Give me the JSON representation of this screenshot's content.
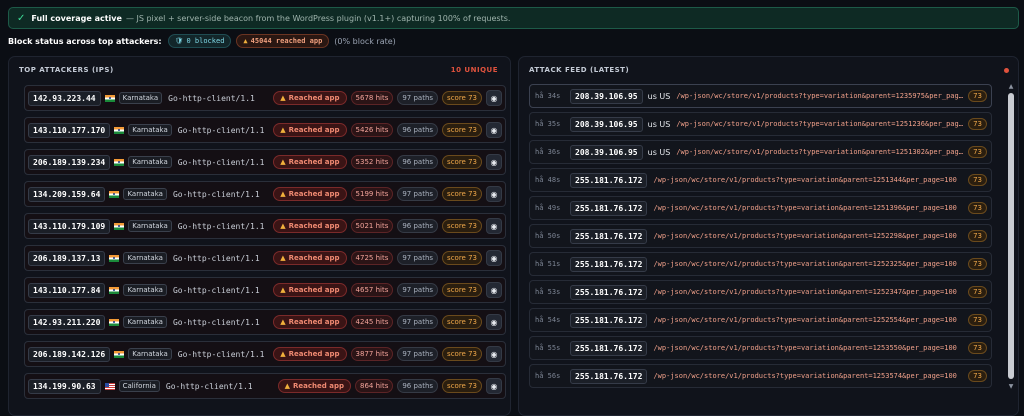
{
  "banner": {
    "icon": "check-icon",
    "title": "Full coverage active",
    "text": "— JS pixel + server-side beacon from the WordPress plugin (v1.1+) capturing 100% of requests."
  },
  "block_status": {
    "label": "Block status across top attackers:",
    "blocked": "0 blocked",
    "reached": "45044 reached app",
    "rate": "(0% block rate)"
  },
  "attackers": {
    "title": "TOP ATTACKERS (IPS)",
    "count": "10 UNIQUE",
    "rows": [
      {
        "ip": "142.93.223.44",
        "flag": "in",
        "region": "Karnataka",
        "ua": "Go-http-client/1.1",
        "reached": "Reached app",
        "hits": "5678 hits",
        "paths": "97 paths",
        "score": "score 73"
      },
      {
        "ip": "143.110.177.170",
        "flag": "in",
        "region": "Karnataka",
        "ua": "Go-http-client/1.1",
        "reached": "Reached app",
        "hits": "5426 hits",
        "paths": "96 paths",
        "score": "score 73"
      },
      {
        "ip": "206.189.139.234",
        "flag": "in",
        "region": "Karnataka",
        "ua": "Go-http-client/1.1",
        "reached": "Reached app",
        "hits": "5352 hits",
        "paths": "96 paths",
        "score": "score 73"
      },
      {
        "ip": "134.209.159.64",
        "flag": "in",
        "region": "Karnataka",
        "ua": "Go-http-client/1.1",
        "reached": "Reached app",
        "hits": "5199 hits",
        "paths": "97 paths",
        "score": "score 73"
      },
      {
        "ip": "143.110.179.109",
        "flag": "in",
        "region": "Karnataka",
        "ua": "Go-http-client/1.1",
        "reached": "Reached app",
        "hits": "5021 hits",
        "paths": "96 paths",
        "score": "score 73"
      },
      {
        "ip": "206.189.137.13",
        "flag": "in",
        "region": "Karnataka",
        "ua": "Go-http-client/1.1",
        "reached": "Reached app",
        "hits": "4725 hits",
        "paths": "97 paths",
        "score": "score 73"
      },
      {
        "ip": "143.110.177.84",
        "flag": "in",
        "region": "Karnataka",
        "ua": "Go-http-client/1.1",
        "reached": "Reached app",
        "hits": "4657 hits",
        "paths": "97 paths",
        "score": "score 73"
      },
      {
        "ip": "142.93.211.220",
        "flag": "in",
        "region": "Karnataka",
        "ua": "Go-http-client/1.1",
        "reached": "Reached app",
        "hits": "4245 hits",
        "paths": "97 paths",
        "score": "score 73"
      },
      {
        "ip": "206.189.142.126",
        "flag": "in",
        "region": "Karnataka",
        "ua": "Go-http-client/1.1",
        "reached": "Reached app",
        "hits": "3877 hits",
        "paths": "97 paths",
        "score": "score 73"
      },
      {
        "ip": "134.199.90.63",
        "flag": "us",
        "region": "California",
        "ua": "Go-http-client/1.1",
        "reached": "Reached app",
        "hits": "864 hits",
        "paths": "96 paths",
        "score": "score 73"
      }
    ]
  },
  "feed": {
    "title": "ATTACK FEED (LATEST)",
    "rows": [
      {
        "ts": "hå 34s",
        "ip": "208.39.106.95",
        "cc": "us US",
        "path": "/wp-json/wc/store/v1/products?type=variation&parent=1235975&per_pag…",
        "score": "73"
      },
      {
        "ts": "hå 35s",
        "ip": "208.39.106.95",
        "cc": "us US",
        "path": "/wp-json/wc/store/v1/products?type=variation&parent=1251236&per_pag…",
        "score": "73"
      },
      {
        "ts": "hå 36s",
        "ip": "208.39.106.95",
        "cc": "us US",
        "path": "/wp-json/wc/store/v1/products?type=variation&parent=1251302&per_pag…",
        "score": "73"
      },
      {
        "ts": "hå 48s",
        "ip": "255.181.76.172",
        "cc": "",
        "path": "/wp-json/wc/store/v1/products?type=variation&parent=1251344&per_page=100",
        "score": "73"
      },
      {
        "ts": "hå 49s",
        "ip": "255.181.76.172",
        "cc": "",
        "path": "/wp-json/wc/store/v1/products?type=variation&parent=1251396&per_page=100",
        "score": "73"
      },
      {
        "ts": "hå 50s",
        "ip": "255.181.76.172",
        "cc": "",
        "path": "/wp-json/wc/store/v1/products?type=variation&parent=1252298&per_page=100",
        "score": "73"
      },
      {
        "ts": "hå 51s",
        "ip": "255.181.76.172",
        "cc": "",
        "path": "/wp-json/wc/store/v1/products?type=variation&parent=1252325&per_page=100",
        "score": "73"
      },
      {
        "ts": "hå 53s",
        "ip": "255.181.76.172",
        "cc": "",
        "path": "/wp-json/wc/store/v1/products?type=variation&parent=1252347&per_page=100",
        "score": "73"
      },
      {
        "ts": "hå 54s",
        "ip": "255.181.76.172",
        "cc": "",
        "path": "/wp-json/wc/store/v1/products?type=variation&parent=1252554&per_page=100",
        "score": "73"
      },
      {
        "ts": "hå 55s",
        "ip": "255.181.76.172",
        "cc": "",
        "path": "/wp-json/wc/store/v1/products?type=variation&parent=1253550&per_page=100",
        "score": "73"
      },
      {
        "ts": "hå 56s",
        "ip": "255.181.76.172",
        "cc": "",
        "path": "/wp-json/wc/store/v1/products?type=variation&parent=1253574&per_page=100",
        "score": "73"
      }
    ]
  },
  "colors": {
    "background": "#0b0e14",
    "banner_green": "#3ddc97",
    "danger": "#e0523d",
    "score_amber": "#f0a84a"
  }
}
